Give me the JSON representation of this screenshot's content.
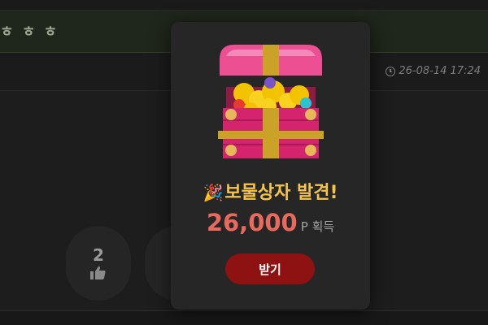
{
  "post": {
    "title": "ㅎ ㅎ ㅎ",
    "date": "26-08-14 17:24",
    "upvotes": "2"
  },
  "modal": {
    "title": "보물상자 발견!",
    "amount": "26,000",
    "unit": "P 획득",
    "claim_label": "받기",
    "icons": {
      "popper": "party-popper-icon",
      "chest": "treasure-chest-icon"
    }
  },
  "colors": {
    "title": "#f5c44a",
    "amount": "#e86a5d",
    "button": "#8e1212",
    "chest_body": "#d4246d",
    "chest_lid": "#ec4f92",
    "gold": "#c9a227"
  }
}
